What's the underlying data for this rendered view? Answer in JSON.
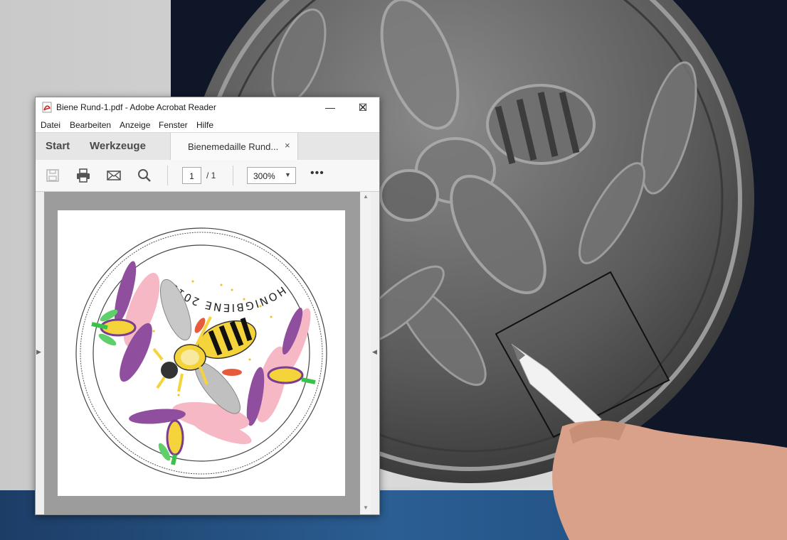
{
  "window": {
    "title": "Biene Rund-1.pdf - Adobe Acrobat Reader",
    "controls": [
      "minimize",
      "maximize",
      "close"
    ]
  },
  "menu": {
    "items": [
      "Datei",
      "Bearbeiten",
      "Anzeige",
      "Fenster",
      "Hilfe"
    ]
  },
  "tabs": {
    "start": "Start",
    "tools": "Werkzeuge",
    "document": "Bienemedaille Rund...",
    "close_symbol": "×"
  },
  "toolbar": {
    "icons": [
      "save-icon",
      "print-icon",
      "email-icon",
      "search-icon"
    ],
    "page_current": "1",
    "page_total": "/ 1",
    "zoom": "300%",
    "more": "•••"
  },
  "document": {
    "medal_inscription": "HONIGBIENE 2019"
  },
  "colors": {
    "accent_red": "#c8201b",
    "flower_pink": "#f5b8c4",
    "flower_purple": "#7a3d8f",
    "bee_yellow": "#f5d33a",
    "leaf_green": "#39c24a"
  }
}
